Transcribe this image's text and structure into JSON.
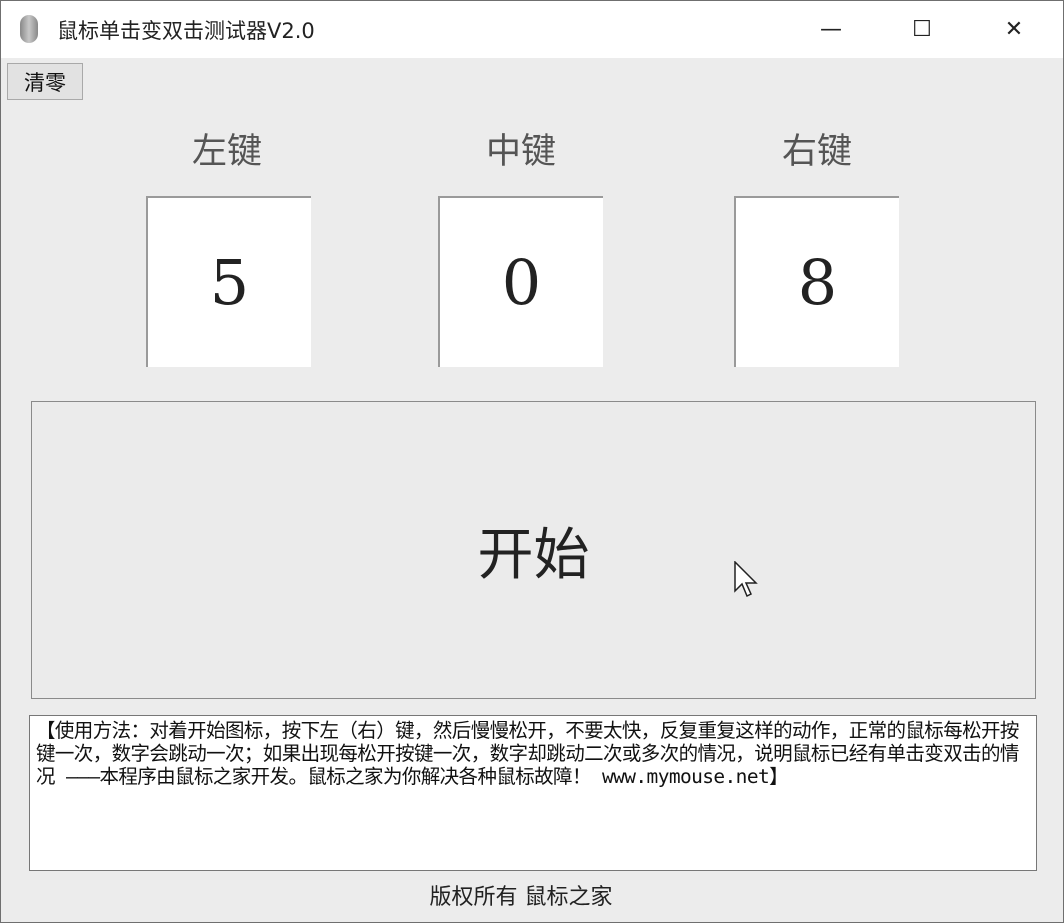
{
  "window": {
    "title": "鼠标单击变双击测试器V2.0",
    "minimize": "—",
    "maximize": "☐",
    "close": "✕"
  },
  "toolbar": {
    "clear_label": "清零"
  },
  "counters": [
    {
      "label": "左键",
      "value": "5"
    },
    {
      "label": "中键",
      "value": "0"
    },
    {
      "label": "右键",
      "value": "8"
    }
  ],
  "start_label": "开始",
  "instructions": "【使用方法：对着开始图标，按下左（右）键，然后慢慢松开，不要太快，反复重复这样的动作，正常的鼠标每松开按键一次，数字会跳动一次；如果出现每松开按键一次，数字却跳动二次或多次的情况，说明鼠标已经有单击变双击的情况 ———本程序由鼠标之家开发。鼠标之家为你解决各种鼠标故障！ www.mymouse.net】",
  "footer": "版权所有 鼠标之家"
}
